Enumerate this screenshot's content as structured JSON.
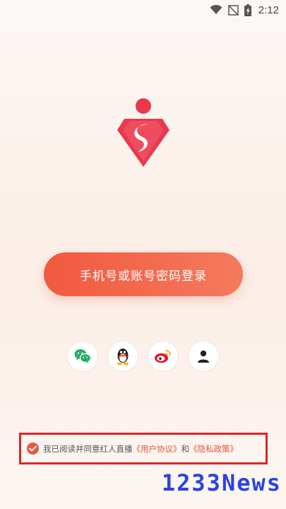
{
  "status_bar": {
    "time": "2:12",
    "icons": [
      "wifi-icon",
      "no-signal-icon",
      "battery-icon"
    ]
  },
  "logo": {
    "icon": "diamond-s-logo",
    "colors": {
      "primary": "#e8394f"
    }
  },
  "login": {
    "button_label": "手机号或账号密码登录",
    "accent_color": "#f2593f"
  },
  "social_logins": [
    {
      "id": "wechat",
      "icon": "wechat-icon",
      "color": "#2aae67"
    },
    {
      "id": "qq",
      "icon": "qq-penguin-icon",
      "color": "#222222"
    },
    {
      "id": "weibo",
      "icon": "weibo-icon",
      "color": "#e6162d"
    },
    {
      "id": "guest",
      "icon": "person-icon",
      "color": "#222222"
    }
  ],
  "agreement": {
    "checked": true,
    "prefix": "我已阅读并同意红人直播",
    "user_agreement": "《用户协议》",
    "conjunction": "和",
    "privacy_policy": "《隐私政策》"
  },
  "watermark": {
    "text": "1233News",
    "color": "#2c42e0"
  }
}
